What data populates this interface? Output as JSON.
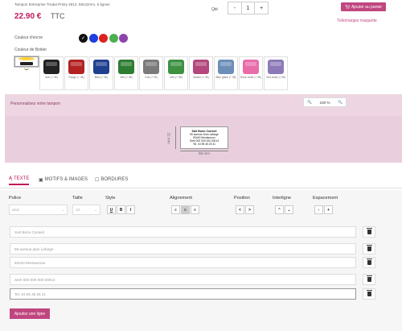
{
  "product": {
    "title": "Tampon Entreprise Trodat Printy 4913, 58x22mm, 5 lignes",
    "price": "22.90 €",
    "tax": "TTC"
  },
  "quantity": {
    "label": "Qté",
    "minus": "-",
    "value": "1",
    "plus": "+"
  },
  "cart": {
    "label": "Ajouter au panier",
    "icon": "cart-icon"
  },
  "download_label": "Téléchargez maquette",
  "ink": {
    "label": "Couleur d'encre",
    "colors": [
      "#111111",
      "#1e3fe0",
      "#e02020",
      "#4caf50",
      "#8e44ad"
    ],
    "selected_mark": "✓"
  },
  "case": {
    "label": "Couleur de Boitier",
    "items": [
      {
        "name": "Intellicam",
        "color": "#ffd33d"
      },
      {
        "name": "Noir (+ 0€)",
        "color": "#222222"
      },
      {
        "name": "Rouge (+ 0€)",
        "color": "#b22222"
      },
      {
        "name": "Bleu (+ 0€)",
        "color": "#1f3f8f"
      },
      {
        "name": "Vert (+ 0€)",
        "color": "#2e7d32"
      },
      {
        "name": "Gris (+ 0€)",
        "color": "#7a7a7a"
      },
      {
        "name": "Vert (+ 0€)",
        "color": "#3d9140"
      },
      {
        "name": "Marine (+ 0€)",
        "color": "#b3477d"
      },
      {
        "name": "Bleu glacé (+ 0€)",
        "color": "#6c8fb8"
      },
      {
        "name": "Rose violet (+ 0€)",
        "color": "#e86ca8"
      },
      {
        "name": "Vert violet (+ 0€)",
        "color": "#8c7ab8"
      }
    ]
  },
  "customize": {
    "title": "Personnalisez votre tampon",
    "zoom_out": "🔍",
    "zoom": "100 %",
    "zoom_in": "🔍"
  },
  "stamp": {
    "lines": [
      "Sarl Bono Conseil",
      "59 avenue Jean Lafarge",
      "83440 Montauroux",
      "Siret 000 000 000 00014",
      "Tel. 04 95 45 25 41"
    ],
    "width_label": "58 mm",
    "height_label": "22 mm"
  },
  "tabs": [
    {
      "label": "TEXTE",
      "icon": "Ą"
    },
    {
      "label": "MOTIFS & IMAGES",
      "icon": "▣"
    },
    {
      "label": "BORDURES",
      "icon": "☐"
    }
  ],
  "editor": {
    "font": {
      "label": "Police",
      "value": "arial"
    },
    "size": {
      "label": "Taille",
      "value": "10"
    },
    "style": {
      "label": "Style",
      "buttons": [
        "U",
        "B",
        "I"
      ]
    },
    "align": {
      "label": "Alignement",
      "buttons": [
        "≡",
        "≡",
        "≡"
      ]
    },
    "position": {
      "label": "Position",
      "buttons": [
        "<",
        ">"
      ]
    },
    "spacing": {
      "label": "Interligne",
      "buttons": [
        "⌃",
        "⌄"
      ]
    },
    "letter": {
      "label": "Espacement",
      "buttons": [
        "-",
        "+"
      ]
    },
    "lines": [
      "Sarl Bono Conseil",
      "59 avenue jean Lafarge",
      "83440 Montauroux",
      "Siret 000 000 000 00014",
      "Tel. 04 95 45 25 41"
    ],
    "add_line": "Ajoutez une ligne"
  }
}
